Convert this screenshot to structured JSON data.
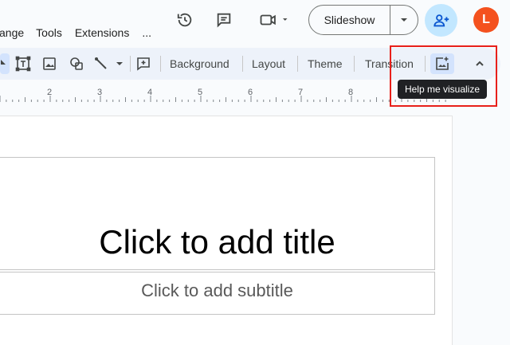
{
  "menu": {
    "items": [
      "ange",
      "Tools",
      "Extensions",
      "..."
    ]
  },
  "header": {
    "slideshow_label": "Slideshow",
    "avatar_initial": "L",
    "icons": [
      "history-icon",
      "comment-icon",
      "video-call-icon",
      "share-icon"
    ]
  },
  "toolbar": {
    "background_label": "Background",
    "layout_label": "Layout",
    "theme_label": "Theme",
    "transition_label": "Transition"
  },
  "tooltip": {
    "text": "Help me visualize"
  },
  "ruler": {
    "numbers": [
      "2",
      "3",
      "4",
      "5",
      "6",
      "7",
      "8"
    ]
  },
  "slide": {
    "title_placeholder": "Click to add title",
    "subtitle_placeholder": "Click to add subtitle"
  },
  "colors": {
    "toolbar_bg": "#edf2fa",
    "share_bg": "#c2e7ff",
    "avatar_bg": "#f4511e",
    "highlight": "#e8201a",
    "tooltip_bg": "#202124",
    "selected_bg": "#d3e3fd"
  }
}
